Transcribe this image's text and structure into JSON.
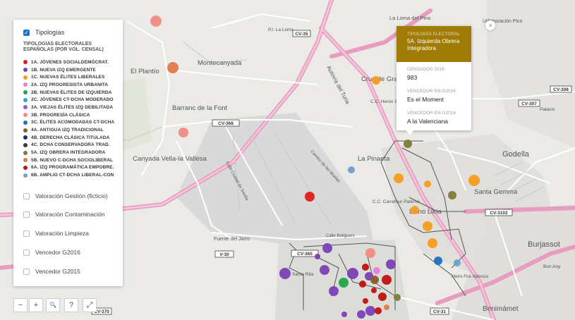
{
  "layers": [
    {
      "label": "Tipologías",
      "checked": true
    },
    {
      "label": "Valoración Gestión (ficticio)",
      "checked": false
    },
    {
      "label": "Valoración Contaminación",
      "checked": false
    },
    {
      "label": "Valoración Limpieza",
      "checked": false
    },
    {
      "label": "Vencedor G2016",
      "checked": false
    },
    {
      "label": "Vencedor G2015",
      "checked": false
    }
  ],
  "legend": {
    "title": "TIPOLOGÍAS ELECTORALES ESPAÑOLAS (POR VOL. CENSAL)",
    "items": [
      {
        "label": "1A. JÓVENES SOCIALDEMÓCRAT.",
        "color": "#e31a1c"
      },
      {
        "label": "1B. NUEVA IZQ EMERGENTE",
        "color": "#7b3fb5"
      },
      {
        "label": "1C. NUEVAS ÉLITES LIBERALES",
        "color": "#f59b1b"
      },
      {
        "label": "2A. IZQ PROGRESISTA URBANITA",
        "color": "#e07fe0"
      },
      {
        "label": "2B. NUEVAS ÉLITES DE IZQUIERDA",
        "color": "#1fa34a"
      },
      {
        "label": "2C. JÓVENES CT-DCHA MODERADO",
        "color": "#2aa7d8"
      },
      {
        "label": "3A. VIEJAS ÉLITES IZQ DEBILITADA",
        "color": "#9b59d0"
      },
      {
        "label": "3B. PROGRESÍA CLÁSICA",
        "color": "#f08c84"
      },
      {
        "label": "3C. ÉLITES ACOMODADAS CT-DCHA",
        "color": "#1e6fc2"
      },
      {
        "label": "4A. ANTIGUA IZQ TRADICIONAL",
        "color": "#8a5a2b"
      },
      {
        "label": "4B. DERECHA CLÁSICA TITULADA",
        "color": "#12316e"
      },
      {
        "label": "4C. DCHA CONSERVADORA TRAD.",
        "color": "#3a3a3a"
      },
      {
        "label": "5A. IZQ OBRERA INTEGRADORA",
        "color": "#7d7a3b"
      },
      {
        "label": "5B. NUEVO C-DCHA SOCIOLIBERAL",
        "color": "#e07a4a"
      },
      {
        "label": "6A. IZQ PROGRAMÁTICA EMPOBRE.",
        "color": "#c01010"
      },
      {
        "label": "6B. AMPLIO CT-DCHA LIBERAL-CON",
        "color": "#6fa0d0"
      }
    ]
  },
  "tooltip": {
    "category_label": "TIPOLOGÍA ELECTORAL",
    "title": "5A. Izquierda Obrera Integradora",
    "census_label": "CENSADOS 2016",
    "census_value": "983",
    "winner2016_label": "VENCEDOR EN G2016",
    "winner2016_value": "Es el Moment",
    "winner2015_label": "VENCEDOR EN G2016",
    "winner2015_value": "A la Valenciana",
    "close_symbol": "×"
  },
  "controls": {
    "zoom_out": "−",
    "zoom_in": "+",
    "search": "🔍",
    "help": "?",
    "fullscreen": "⤢"
  },
  "places": [
    "El Plantío",
    "Montecanyada",
    "Barranc de la Font",
    "Canyada Vella-la Vallesa",
    "Cruz de Gracia",
    "La Pinaeta",
    "Llano Lliria",
    "Santa Gemma",
    "Godella",
    "Burjassot",
    "Benimámet",
    "Fuente del Jarro",
    "Autovía del Turia",
    "La Loma del Pino",
    "Urbanización Pico",
    "C.C. Carrefour Paterna",
    "Camino de las Muelas",
    "Calle Ciudad de Sevilla",
    "Metro-Fira València",
    "P.I. La Loma",
    "Calle Botiguers",
    "C.C. Heron City",
    "Santa Rita",
    "Bon Any",
    "Palacio",
    "CV-35",
    "CV-308",
    "CV-307",
    "CV-3102",
    "CV-365",
    "CV-368",
    "V-30",
    "CV-31",
    "CV-370"
  ],
  "points": [
    {
      "color": "#f08c84",
      "lon": 0
    },
    {
      "color": "#e07a4a"
    },
    {
      "color": "#f08c84"
    },
    {
      "color": "#e31a1c"
    },
    {
      "color": "#6fa0d0"
    },
    {
      "color": "#f59b1b"
    },
    {
      "color": "#7d7a3b"
    },
    {
      "color": "#f59b1b"
    },
    {
      "color": "#f59b1b"
    },
    {
      "color": "#f59b1b"
    },
    {
      "color": "#7d7a3b"
    },
    {
      "color": "#f59b1b"
    },
    {
      "color": "#f59b1b"
    },
    {
      "color": "#f59b1b"
    },
    {
      "color": "#1e6fc2"
    },
    {
      "color": "#6fa0d0"
    },
    {
      "color": "#7b3fb5"
    },
    {
      "color": "#7b3fb5"
    },
    {
      "color": "#7b3fb5"
    },
    {
      "color": "#f08c84"
    },
    {
      "color": "#7b3fb5"
    },
    {
      "color": "#7b3fb5"
    },
    {
      "color": "#1fa34a"
    },
    {
      "color": "#7b3fb5"
    },
    {
      "color": "#c01010"
    },
    {
      "color": "#c01010"
    },
    {
      "color": "#e07fe0"
    },
    {
      "color": "#7b3fb5"
    },
    {
      "color": "#c01010"
    },
    {
      "color": "#8a5a2b"
    },
    {
      "color": "#c01010"
    },
    {
      "color": "#7b3fb5"
    },
    {
      "color": "#c01010"
    },
    {
      "color": "#7b3fb5"
    },
    {
      "color": "#c01010"
    },
    {
      "color": "#7b3fb5"
    },
    {
      "color": "#c01010"
    },
    {
      "color": "#e07a4a"
    },
    {
      "color": "#7d7a3b"
    },
    {
      "color": "#7b3fb5"
    }
  ]
}
